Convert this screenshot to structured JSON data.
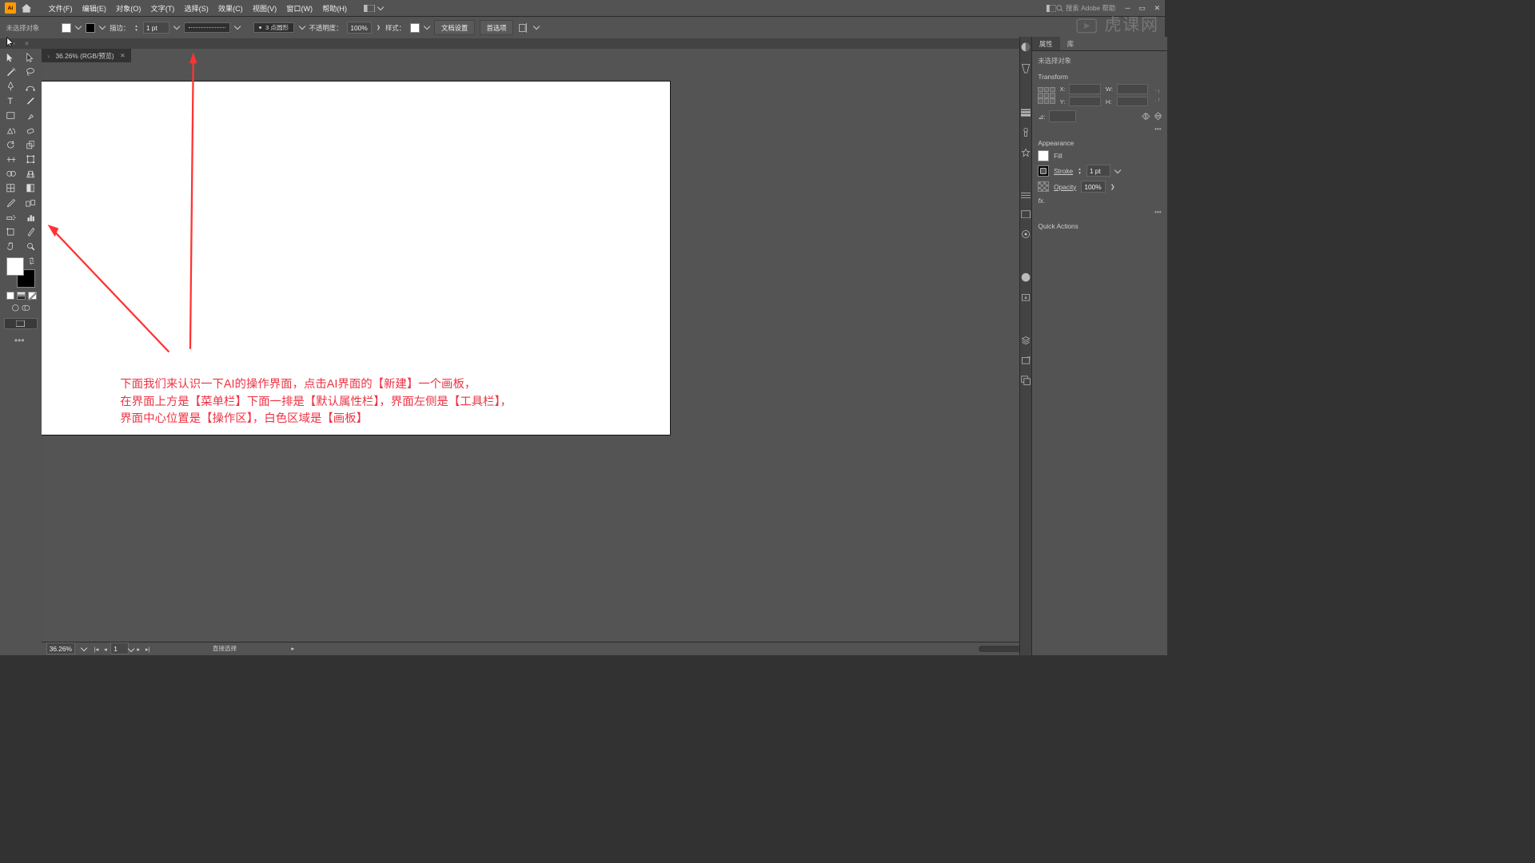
{
  "menubar": {
    "items": [
      "文件(F)",
      "编辑(E)",
      "对象(O)",
      "文字(T)",
      "选择(S)",
      "效果(C)",
      "视图(V)",
      "窗口(W)",
      "帮助(H)"
    ],
    "search_placeholder": "搜索 Adobe 帮助"
  },
  "propbar": {
    "no_selection": "未选择对象",
    "stroke_label": "描边：",
    "stroke_width": "1 pt",
    "dash_option": "3 点圆形",
    "opacity_label": "不透明度：",
    "opacity_value": "100%",
    "style_label": "样式：",
    "doc_setup": "文档设置",
    "prefs": "首选项"
  },
  "doc_tab": {
    "title": "36.26% (RGB/预览)"
  },
  "statusbar": {
    "zoom": "36.26%",
    "page": "1",
    "tool": "直接选择"
  },
  "overlay": {
    "line1": "下面我们来认识一下AI的操作界面，点击AI界面的【新建】一个画板，",
    "line2": "在界面上方是【菜单栏】下面一排是【默认属性栏】，界面左侧是【工具栏】，",
    "line3": "界面中心位置是【操作区】，白色区域是【画板】"
  },
  "panel": {
    "tabs": {
      "properties": "属性",
      "library": "库"
    },
    "no_selection": "未选择对象",
    "transform_title": "Transform",
    "tf": {
      "x_label": "X:",
      "y_label": "Y:",
      "w_label": "W:",
      "h_label": "H:",
      "angle_label": "⊿:",
      "x": "",
      "y": "",
      "w": "",
      "h": "",
      "angle": ""
    },
    "appearance_title": "Appearance",
    "fill_label": "Fill",
    "stroke_label": "Stroke",
    "stroke_val": "1 pt",
    "opacity_label": "Opacity",
    "opacity_val": "100%",
    "fx_label": "fx.",
    "quick_actions": "Quick Actions"
  },
  "watermark": "虎课网"
}
